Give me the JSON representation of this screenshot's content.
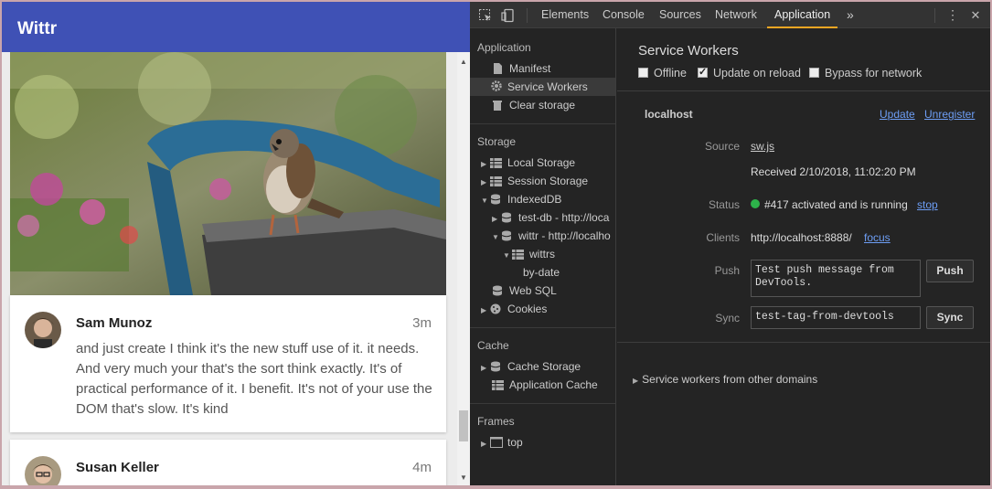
{
  "app": {
    "title": "Wittr",
    "posts": [
      {
        "author": "Sam Munoz",
        "time": "3m",
        "body": "and just create I think it's the new stuff use of it. it needs. And very much your that's the sort think exactly. It's of practical performance of it. I benefit. It's not of your use the DOM that's slow. It's kind"
      },
      {
        "author": "Susan Keller",
        "time": "4m",
        "body": ""
      }
    ]
  },
  "devtools": {
    "tabs": [
      "Elements",
      "Console",
      "Sources",
      "Network",
      "Application"
    ],
    "active_tab": "Application",
    "more_tabs_glyph": "»",
    "sidebar": {
      "application_heading": "Application",
      "application_items": [
        "Manifest",
        "Service Workers",
        "Clear storage"
      ],
      "storage_heading": "Storage",
      "storage_items": [
        "Local Storage",
        "Session Storage",
        "IndexedDB",
        "test-db - http://loca",
        "wittr - http://localho",
        "wittrs",
        "by-date",
        "Web SQL",
        "Cookies"
      ],
      "cache_heading": "Cache",
      "cache_items": [
        "Cache Storage",
        "Application Cache"
      ],
      "frames_heading": "Frames",
      "frames_items": [
        "top"
      ]
    },
    "main": {
      "title": "Service Workers",
      "options": {
        "offline": {
          "label": "Offline",
          "checked": false
        },
        "update_on_reload": {
          "label": "Update on reload",
          "checked": true
        },
        "bypass": {
          "label": "Bypass for network",
          "checked": false
        }
      },
      "origin": "localhost",
      "update_link": "Update",
      "unregister_link": "Unregister",
      "source_label": "Source",
      "source_file": "sw.js",
      "received": "Received 2/10/2018, 11:02:20 PM",
      "status_label": "Status",
      "status_text": "#417 activated and is running",
      "status_color": "#2db34a",
      "stop_link": "stop",
      "clients_label": "Clients",
      "clients_url": "http://localhost:8888/",
      "focus_link": "focus",
      "push_label": "Push",
      "push_message": "Test push message from DevTools.",
      "push_button": "Push",
      "sync_label": "Sync",
      "sync_tag": "test-tag-from-devtools",
      "sync_button": "Sync",
      "other_domains": "Service workers from other domains"
    }
  },
  "colors": {
    "header": "#3f51b5",
    "accent_tab": "#f5a623",
    "link": "#6d9ef5"
  }
}
